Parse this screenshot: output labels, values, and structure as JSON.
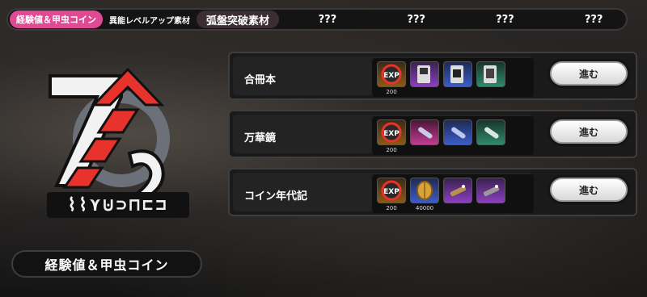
{
  "tabs": [
    {
      "label": "経験値＆甲虫コイン",
      "state": "active"
    },
    {
      "label": "異能レベルアップ素材",
      "state": "normal"
    },
    {
      "label": "弧盤突破素材",
      "state": "highlighted"
    },
    {
      "label": "???",
      "state": "locked"
    },
    {
      "label": "???",
      "state": "locked"
    },
    {
      "label": "???",
      "state": "locked"
    },
    {
      "label": "???",
      "state": "locked"
    }
  ],
  "section_label": "経験値＆甲虫コイン",
  "rows": [
    {
      "name": "合冊本",
      "button": "進む",
      "items": [
        {
          "icon": "exp-badge-icon",
          "rarity": "gold",
          "qty": "200"
        },
        {
          "icon": "book-icon",
          "rarity": "purple",
          "qty": ""
        },
        {
          "icon": "book-icon",
          "rarity": "blue",
          "qty": ""
        },
        {
          "icon": "book-icon",
          "rarity": "green",
          "qty": ""
        }
      ]
    },
    {
      "name": "万華鏡",
      "button": "進む",
      "items": [
        {
          "icon": "exp-badge-icon",
          "rarity": "gold",
          "qty": "200"
        },
        {
          "icon": "kaleidoscope-icon",
          "rarity": "pink",
          "qty": ""
        },
        {
          "icon": "kaleidoscope-icon",
          "rarity": "blue",
          "qty": ""
        },
        {
          "icon": "kaleidoscope-icon",
          "rarity": "green",
          "qty": ""
        }
      ]
    },
    {
      "name": "コイン年代記",
      "button": "進む",
      "items": [
        {
          "icon": "exp-badge-icon",
          "rarity": "gold",
          "qty": "200"
        },
        {
          "icon": "beetle-coin-icon",
          "rarity": "blue",
          "qty": "40000"
        },
        {
          "icon": "telescope-icon",
          "rarity": "purple",
          "qty": ""
        },
        {
          "icon": "telescope-icon",
          "rarity": "purple",
          "qty": ""
        }
      ]
    }
  ],
  "colors": {
    "accent": "#e04a93",
    "logo_red": "#e8322c"
  }
}
